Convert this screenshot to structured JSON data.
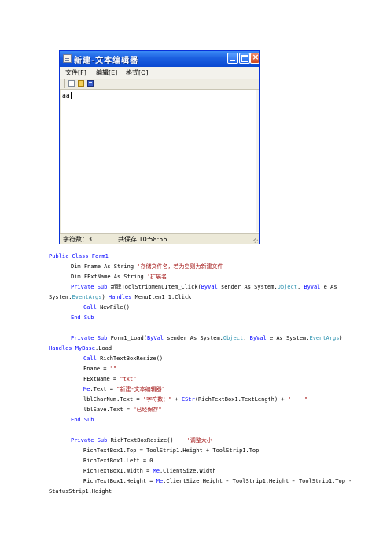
{
  "window": {
    "title": "新建-文本编辑器",
    "menu": [
      "文件[F]",
      "编辑[E]",
      "格式[O]"
    ],
    "toolbar_icons": [
      "new-file-icon",
      "open-folder-icon",
      "save-disk-icon"
    ],
    "editor_text": "aa",
    "status": {
      "char_count": "字符数：3",
      "save_time": "共保存 10:58:56"
    }
  },
  "code": {
    "l01": "Public Class Form1",
    "l02a": "Dim Fname As String",
    "l02b": " '存储文件名，若为空则为新建文件",
    "l03a": "Dim FExtName As String",
    "l03b": " '扩展名",
    "l04a": "Private Sub",
    "l04b": " 新建ToolStripMenuItem_Click(",
    "l04c": "ByVal",
    "l04d": " sender As System.",
    "l04e": "Object",
    "l04f": ", ",
    "l04g": "ByVal",
    "l04h": " e As",
    "l05a": "System.",
    "l05b": "EventArgs",
    "l05c": ") ",
    "l05d": "Handles",
    "l05e": " MenuItem1_1.Click",
    "l06a": "Call",
    "l06b": " NewFile()",
    "l07": "End Sub",
    "l09a": "Private Sub",
    "l09b": " Form1_Load(",
    "l09c": "ByVal",
    "l09d": " sender As System.",
    "l09e": "Object",
    "l09f": ", ",
    "l09g": "ByVal",
    "l09h": " e As System.",
    "l09i": "EventArgs",
    "l09j": ")",
    "l10a": "Handles",
    "l10b": " MyBase",
    "l10c": ".Load",
    "l11a": "Call",
    "l11b": " RichTextBoxResize()",
    "l12a": "Fname = ",
    "l12b": "\"\"",
    "l13a": "FExtName = ",
    "l13b": "\"txt\"",
    "l14a": "Me",
    "l14b": ".Text = ",
    "l14c": "\"新建-文本编辑器\"",
    "l15a": "lblCharNum.Text = ",
    "l15b": "\"字符数：\"",
    "l15c": " + ",
    "l15d": "CStr",
    "l15e": "(RichTextBox1.TextLength) + ",
    "l15f": "\"    \"",
    "l16a": "lblSave.Text = ",
    "l16b": "\"已经保存\"",
    "l17": "End Sub",
    "l19a": "Private Sub",
    "l19b": " RichTextBoxResize()",
    "l19c": "    '调整大小",
    "l20": "RichTextBox1.Top = ToolStrip1.Height + ToolStrip1.Top",
    "l21": "RichTextBox1.Left = 0",
    "l22a": "RichTextBox1.Width = ",
    "l22b": "Me",
    "l22c": ".ClientSize.Width",
    "l23a": "RichTextBox1.Height = ",
    "l23b": "Me",
    "l23c": ".ClientSize.Height - ToolStrip1.Height - ToolStrip1.Top -",
    "l24": "StatusStrip1.Height"
  }
}
